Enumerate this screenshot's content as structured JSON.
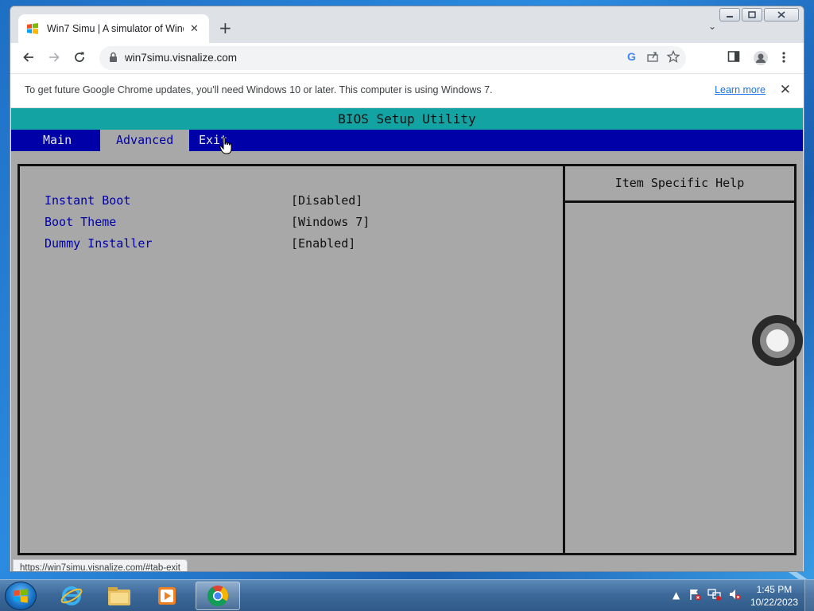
{
  "browser": {
    "tab_title": "Win7 Simu | A simulator of Windows 7",
    "url": "win7simu.visnalize.com",
    "new_tab_symbol": "+",
    "infobar": {
      "message": "To get future Google Chrome updates, you'll need Windows 10 or later. This computer is using Windows 7.",
      "link": "Learn more"
    },
    "status_url": "https://win7simu.visnalize.com/#tab-exit"
  },
  "bios": {
    "title": "BIOS Setup Utility",
    "menu": [
      {
        "label": "Main",
        "active": false
      },
      {
        "label": "Advanced",
        "active": true
      },
      {
        "label": "Exit",
        "active": false
      }
    ],
    "settings": [
      {
        "label": "Instant Boot",
        "value": "[Disabled]"
      },
      {
        "label": "Boot Theme",
        "value": "[Windows 7]"
      },
      {
        "label": "Dummy Installer",
        "value": "[Enabled]"
      }
    ],
    "help_header": "Item Specific Help"
  },
  "taskbar": {
    "time": "1:45 PM",
    "date": "10/22/2023",
    "items": [
      "internet-explorer",
      "file-explorer",
      "media-player",
      "google-chrome"
    ]
  },
  "colors": {
    "bios_title_bg": "#14a3a3",
    "bios_menu_bg": "#0000a8",
    "bios_body_bg": "#a8a8a8",
    "bios_label": "#0000a8"
  }
}
